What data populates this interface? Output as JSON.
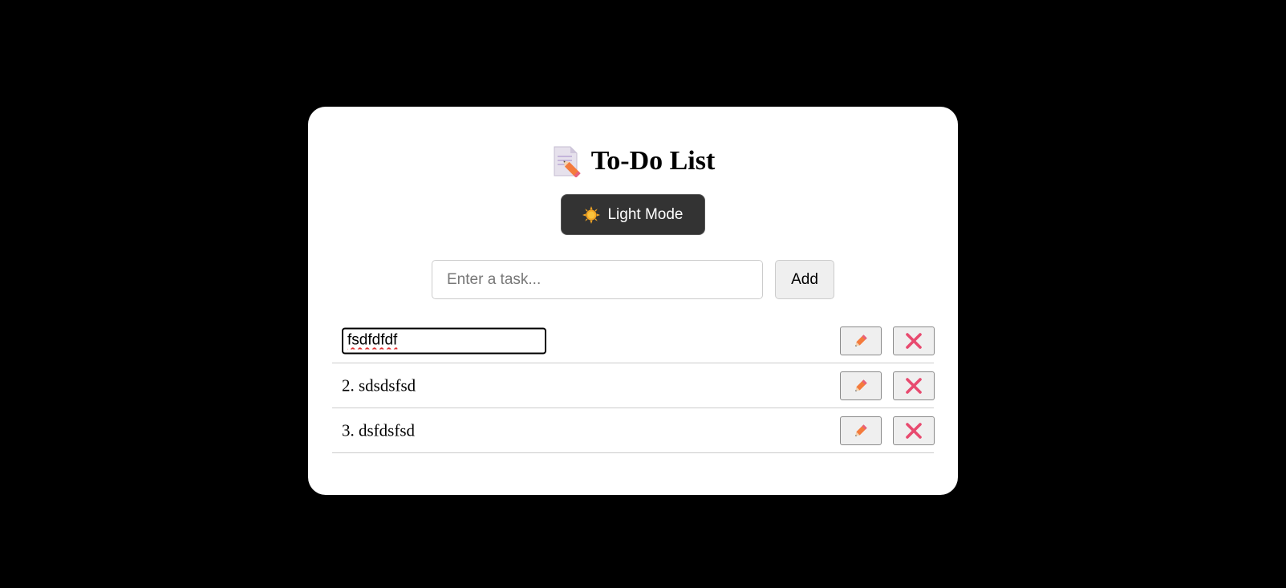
{
  "app": {
    "title": "To-Do List",
    "title_icon": "memo-icon"
  },
  "theme_toggle": {
    "label": "Light Mode",
    "icon": "sun-icon"
  },
  "new_task": {
    "placeholder": "Enter a task...",
    "value": "",
    "add_label": "Add"
  },
  "tasks": [
    {
      "editing": true,
      "edit_value": "fsdfdfdf",
      "text": ""
    },
    {
      "editing": false,
      "text": "2. sdsdsfsd"
    },
    {
      "editing": false,
      "text": "3. dsfdsfsd"
    }
  ],
  "task_actions": {
    "edit_icon": "pencil-icon",
    "delete_icon": "close-icon"
  },
  "colors": {
    "background": "#000000",
    "card": "#ffffff",
    "theme_button": "#333333",
    "pencil": "#f47b3c",
    "delete": "#e84a6f"
  }
}
